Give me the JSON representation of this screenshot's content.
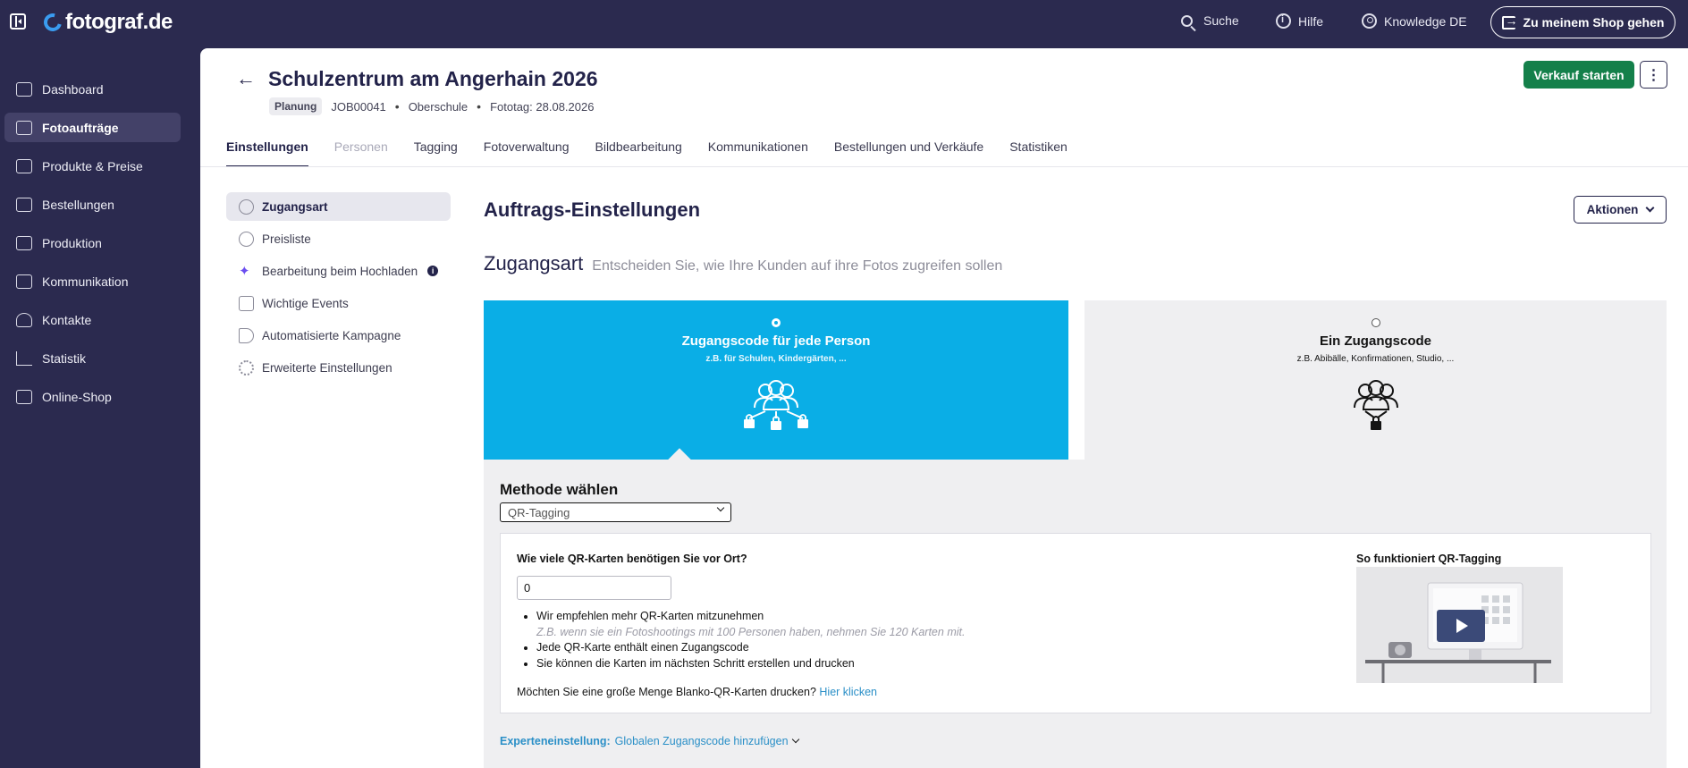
{
  "topbar": {
    "logo_text": "fotograf.de",
    "search_label": "Suche",
    "help_label": "Hilfe",
    "knowledge_label": "Knowledge DE",
    "shop_button_label": "Zu meinem Shop gehen"
  },
  "sidebar": {
    "items": [
      {
        "label": "Dashboard",
        "icon": "home-icon",
        "active": false
      },
      {
        "label": "Fotoaufträge",
        "icon": "image-icon",
        "active": true
      },
      {
        "label": "Produkte & Preise",
        "icon": "cart-icon",
        "active": false
      },
      {
        "label": "Bestellungen",
        "icon": "basket-icon",
        "active": false
      },
      {
        "label": "Produktion",
        "icon": "printer-icon",
        "active": false
      },
      {
        "label": "Kommunikation",
        "icon": "message-icon",
        "active": false
      },
      {
        "label": "Kontakte",
        "icon": "person-icon",
        "active": false
      },
      {
        "label": "Statistik",
        "icon": "chart-icon",
        "active": false
      },
      {
        "label": "Online-Shop",
        "icon": "store-icon",
        "active": false
      }
    ]
  },
  "header": {
    "title": "Schulzentrum am Angerhain 2026",
    "status_badge": "Planung",
    "job_id": "JOB00041",
    "school_type": "Oberschule",
    "photo_day": "Fototag: 28.08.2026",
    "start_sale_label": "Verkauf starten",
    "more_label": "⋮"
  },
  "tabs": [
    {
      "label": "Einstellungen",
      "state": "active"
    },
    {
      "label": "Personen",
      "state": "disabled"
    },
    {
      "label": "Tagging",
      "state": "normal"
    },
    {
      "label": "Fotoverwaltung",
      "state": "normal"
    },
    {
      "label": "Bildbearbeitung",
      "state": "normal"
    },
    {
      "label": "Kommunikationen",
      "state": "normal"
    },
    {
      "label": "Bestellungen und Verkäufe",
      "state": "normal"
    },
    {
      "label": "Statistiken",
      "state": "normal"
    }
  ],
  "settings_nav": [
    {
      "label": "Zugangsart",
      "icon": "user-key-icon",
      "active": true
    },
    {
      "label": "Preisliste",
      "icon": "dollar-icon",
      "active": false
    },
    {
      "label": "Bearbeitung beim Hochladen",
      "icon": "sparkle-icon",
      "active": false
    },
    {
      "label": "Wichtige Events",
      "icon": "calendar-icon",
      "active": false
    },
    {
      "label": "Automatisierte Kampagne",
      "icon": "megaphone-icon",
      "active": false
    },
    {
      "label": "Erweiterte Einstellungen",
      "icon": "gear-icon",
      "active": false
    }
  ],
  "section": {
    "title": "Auftrags-Einstellungen",
    "actions_label": "Aktionen",
    "access_heading": "Zugangsart",
    "access_subheading": "Entscheiden Sie, wie Ihre Kunden auf ihre Fotos zugreifen sollen"
  },
  "access_options": [
    {
      "title": "Zugangscode für jede Person",
      "subtitle": "z.B. für Schulen, Kindergärten, ...",
      "selected": true
    },
    {
      "title": "Ein Zugangscode",
      "subtitle": "z.B. Abibälle, Konfirmationen, Studio, ...",
      "selected": false
    }
  ],
  "method": {
    "title": "Methode wählen",
    "selected_value": "QR-Tagging",
    "question": "Wie viele QR-Karten benötigen Sie vor Ort?",
    "quantity_value": "0",
    "bullets": [
      "Wir empfehlen mehr QR-Karten mitzunehmen",
      "Z.B. wenn sie ein Fotoshootings mit 100 Personen haben, nehmen Sie 120 Karten mit.",
      "Jede QR-Karte enthält einen Zugangscode",
      "Sie können die Karten im nächsten Schritt erstellen und drucken"
    ],
    "blank_cards_text": "Möchten Sie eine große Menge Blanko-QR-Karten drucken?",
    "blank_cards_link": "Hier klicken",
    "video_title": "So funktioniert QR-Tagging",
    "expert_prefix": "Experteneinstellung:",
    "expert_link": "Globalen Zugangscode hinzufügen"
  },
  "colors": {
    "sidebar_bg": "#2b2a4f",
    "accent_blue": "#0aaee6",
    "sale_green": "#14804a",
    "link_blue": "#2a8fc7"
  }
}
